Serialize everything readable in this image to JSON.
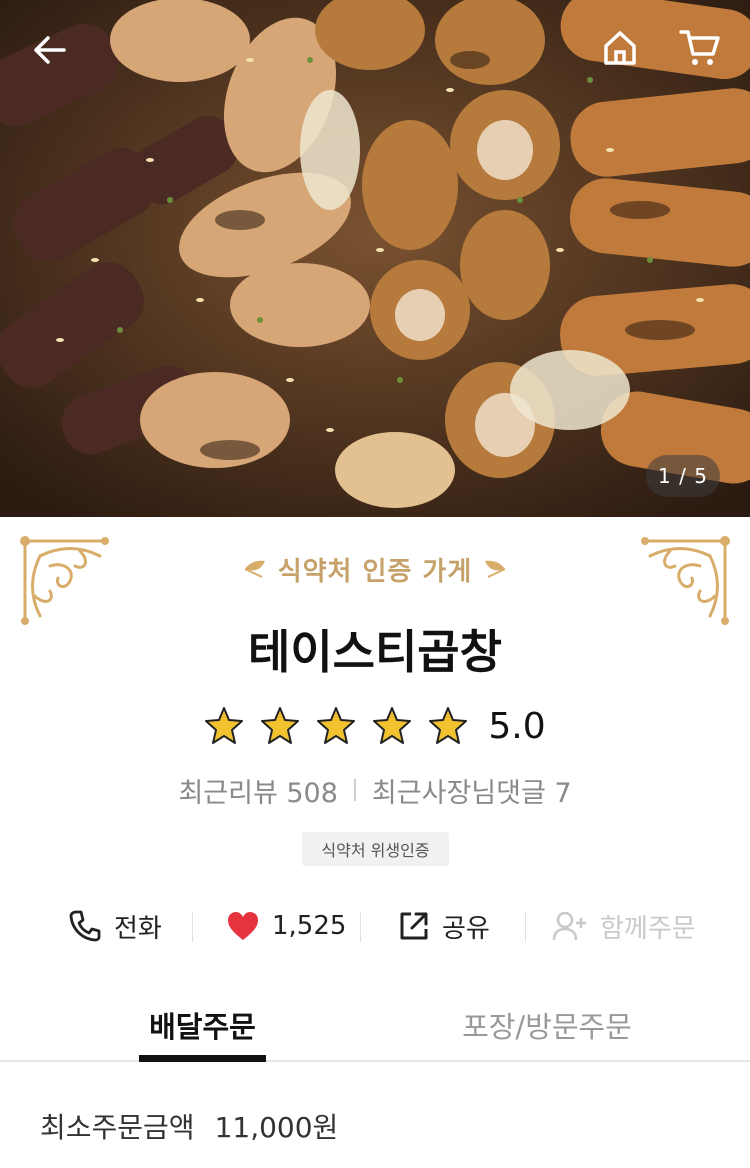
{
  "hero": {
    "counter": "1 / 5",
    "icons": {
      "back": "arrow-left-icon",
      "home": "home-icon",
      "cart": "cart-icon"
    }
  },
  "store": {
    "certification_banner": "식약처 인증 가게",
    "name": "테이스티곱창",
    "rating": "5.0",
    "star_count": 5,
    "recent_reviews_label": "최근리뷰 508",
    "recent_owner_replies_label": "최근사장님댓글 7",
    "hygiene_badge": "식약처 위생인증"
  },
  "actions": {
    "call_label": "전화",
    "like_count": "1,525",
    "share_label": "공유",
    "group_order_label": "함께주문"
  },
  "tabs": {
    "delivery": "배달주문",
    "pickup": "포장/방문주문",
    "selected": "delivery"
  },
  "order_info": {
    "min_order_label": "최소주문금액",
    "min_order_value": "11,000원"
  },
  "colors": {
    "gold": "#c7a16a",
    "star": "#f2c230",
    "heart": "#e5343d",
    "disabled": "#c9c9c9"
  }
}
